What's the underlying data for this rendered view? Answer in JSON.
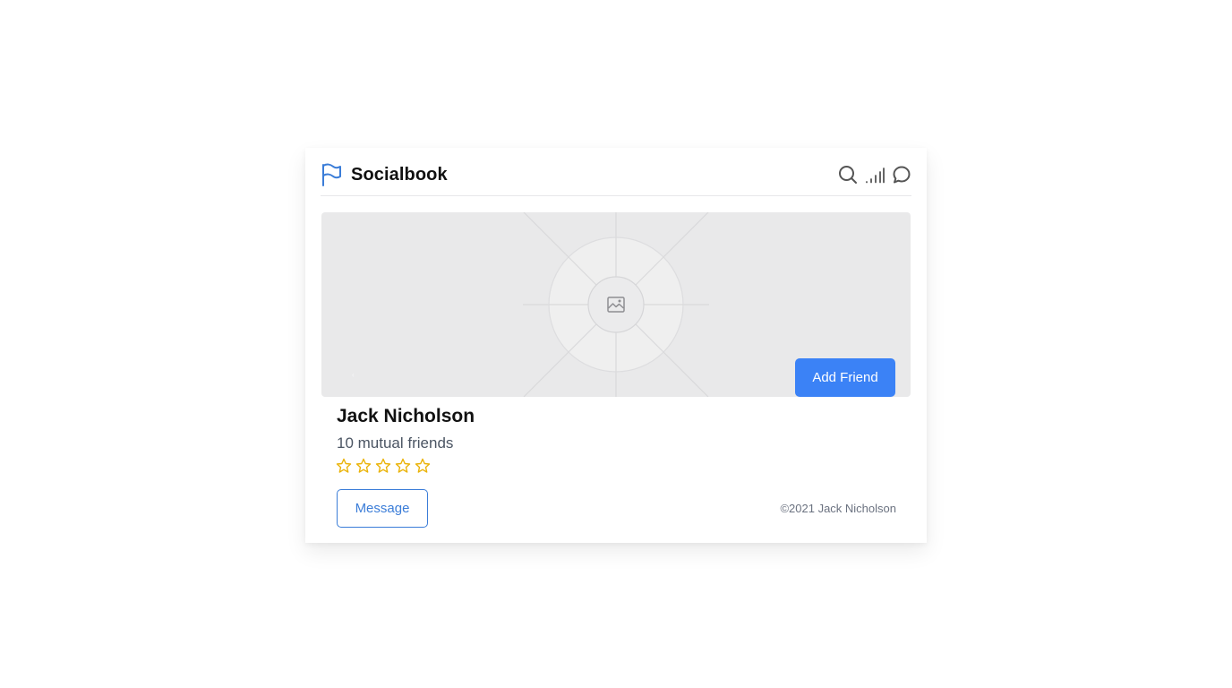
{
  "app": {
    "brand_name": "Socialbook",
    "brand_icon": "flag-icon",
    "header_icons": [
      "search-icon",
      "signal-icon",
      "chat-bubble-icon"
    ]
  },
  "profile": {
    "hero_icon": "image-placeholder-icon",
    "add_friend_label": "Add Friend",
    "name": "Jack Nicholson",
    "mutual_friends": "10 mutual friends",
    "rating": {
      "filled": 0,
      "max": 5,
      "icon": "star-outline-icon"
    },
    "message_label": "Message",
    "copyright": "©2021 Jack Nicholson"
  },
  "colors": {
    "accent": "#3b82f6",
    "star": "#eab308",
    "hero_bg": "#e9e9ea"
  }
}
